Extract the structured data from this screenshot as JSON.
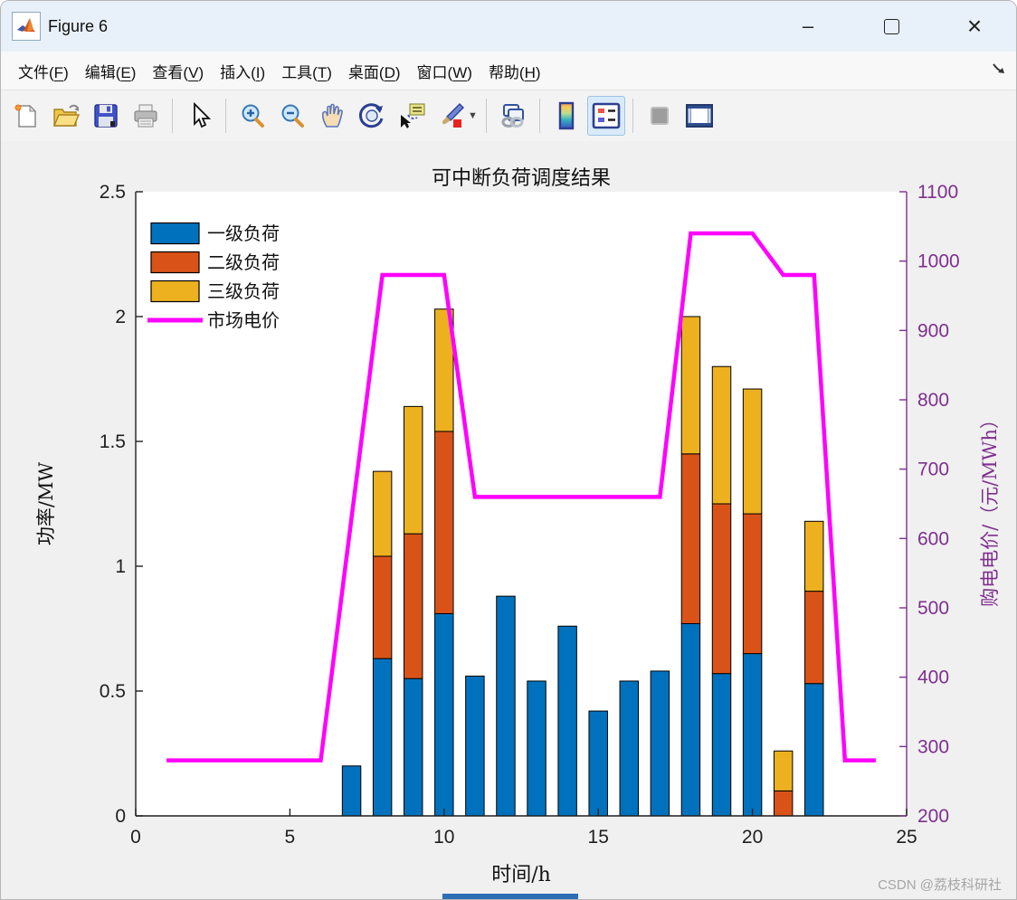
{
  "window": {
    "title": "Figure 6",
    "controls": {
      "minimize": "–",
      "maximize": "",
      "close": "×"
    }
  },
  "menu": {
    "items": [
      "文件(F)",
      "编辑(E)",
      "查看(V)",
      "插入(I)",
      "工具(T)",
      "桌面(D)",
      "窗口(W)",
      "帮助(H)"
    ]
  },
  "toolbar": {
    "icons": [
      "new-figure",
      "open-file",
      "save-figure",
      "print-figure",
      "edit-plot-pointer",
      "zoom-in",
      "zoom-out",
      "pan",
      "rotate-3d",
      "data-cursor",
      "brush-data",
      "link-plot",
      "insert-colorbar",
      "insert-legend",
      "hide-plot-tools",
      "show-plot-tools-dock"
    ],
    "active_icon": "insert-legend"
  },
  "chart_data": {
    "type": "bar",
    "subtype": "stacked-bar-with-line",
    "title": "可中断负荷调度结果",
    "xlabel": "时间/h",
    "ylabel_left": "功率/MW",
    "ylabel_right": "购电电价/（元/MWh）",
    "xlim": [
      0,
      25
    ],
    "ylim_left": [
      0,
      2.5
    ],
    "ylim_right": [
      200,
      1100
    ],
    "x_ticks": [
      0,
      5,
      10,
      15,
      20,
      25
    ],
    "y_left_ticks": [
      0,
      0.5,
      1,
      1.5,
      2,
      2.5
    ],
    "y_right_ticks": [
      200,
      300,
      400,
      500,
      600,
      700,
      800,
      900,
      1000,
      1100
    ],
    "grid": false,
    "legend_position": "top-left-inside",
    "colors": {
      "level1": "#0072BD",
      "level2": "#D95319",
      "level3": "#EDB120",
      "price_line": "#FF00FF",
      "right_axis": "#7E2F8E",
      "axis_text": "#1f1f1f"
    },
    "bar_categories": [
      7,
      8,
      9,
      10,
      11,
      12,
      13,
      14,
      15,
      16,
      17,
      18,
      19,
      20,
      21,
      22
    ],
    "series": [
      {
        "name": "一级负荷",
        "color": "#0072BD",
        "values": [
          0.2,
          0.63,
          0.55,
          0.81,
          0.56,
          0.88,
          0.54,
          0.76,
          0.42,
          0.54,
          0.58,
          0.77,
          0.57,
          0.65,
          0.0,
          0.53
        ]
      },
      {
        "name": "二级负荷",
        "color": "#D95319",
        "values": [
          0.0,
          0.41,
          0.58,
          0.73,
          0.0,
          0.0,
          0.0,
          0.0,
          0.0,
          0.0,
          0.0,
          0.68,
          0.68,
          0.56,
          0.1,
          0.37
        ]
      },
      {
        "name": "三级负荷",
        "color": "#EDB120",
        "values": [
          0.0,
          0.34,
          0.51,
          0.49,
          0.0,
          0.0,
          0.0,
          0.0,
          0.0,
          0.0,
          0.0,
          0.55,
          0.55,
          0.5,
          0.16,
          0.28
        ]
      }
    ],
    "line_series": {
      "name": "市场电价",
      "color": "#FF00FF",
      "width": 4.5,
      "x": [
        1,
        2,
        3,
        4,
        5,
        6,
        7,
        8,
        9,
        10,
        11,
        12,
        13,
        14,
        15,
        16,
        17,
        18,
        19,
        20,
        21,
        22,
        23,
        24
      ],
      "values": [
        280,
        280,
        280,
        280,
        280,
        280,
        630,
        980,
        980,
        980,
        660,
        660,
        660,
        660,
        660,
        660,
        660,
        1040,
        1040,
        1040,
        980,
        980,
        280,
        280
      ]
    }
  },
  "watermark": "CSDN @荔枝科研社"
}
